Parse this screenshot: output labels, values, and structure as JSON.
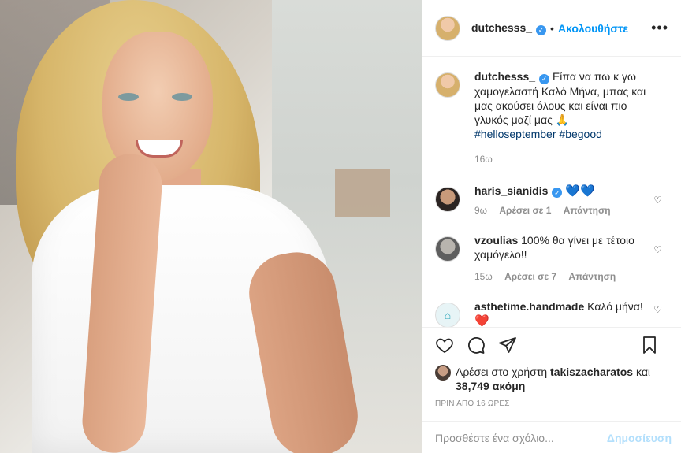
{
  "header": {
    "username": "dutchesss_",
    "follow_label": "Ακολουθήστε",
    "separator": "•",
    "more_label": "•••"
  },
  "caption": {
    "username": "dutchesss_",
    "text": "Είπα να πω κ γω χαμογελαστή Καλό Μήνα, μπας και μας ακούσει όλους και είναι πιο γλυκός μαζί μας 🙏",
    "hashtag1": "#helloseptember",
    "hashtag2": "#begood",
    "time": "16ω"
  },
  "comments": [
    {
      "username": "haris_sianidis",
      "text": "💙💙",
      "time": "9ω",
      "likes": "Αρέσει σε 1",
      "reply": "Απάντηση"
    },
    {
      "username": "vzoulias",
      "text": "100% θα γίνει με τέτοιο χαμόγελο!!",
      "time": "15ω",
      "likes": "Αρέσει σε 7",
      "reply": "Απάντηση"
    },
    {
      "username": "asthetime.handmade",
      "text": "Καλό μήνα!",
      "emoji": "❤️"
    }
  ],
  "likes": {
    "prefix": "Αρέσει στο χρήστη",
    "user": "takiszacharatos",
    "connector": "και",
    "count": "38,749 ακόμη"
  },
  "date": "ΠΡΙΝ ΑΠΟ 16 ΩΡΕΣ",
  "add_comment": {
    "placeholder": "Προσθέστε ένα σχόλιο...",
    "publish": "Δημοσίευση"
  }
}
